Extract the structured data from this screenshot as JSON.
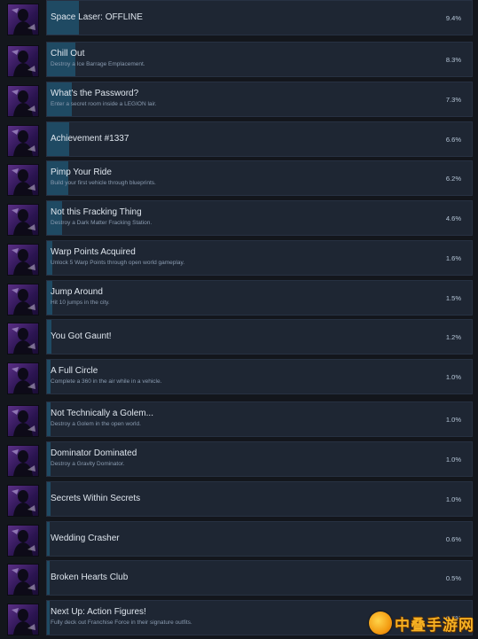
{
  "achievements": [
    {
      "title": "Space Laser: OFFLINE",
      "desc": "",
      "pct": "9.4%",
      "progress": 0.094,
      "icon": "space-laser-icon"
    },
    {
      "title": "Chill Out",
      "desc": "Destroy a Ice Barrage Emplacement.",
      "pct": "8.3%",
      "progress": 0.083,
      "icon": "chill-out-icon"
    },
    {
      "title": "What's the Password?",
      "desc": "Enter a secret room inside a LEGION lair.",
      "pct": "7.3%",
      "progress": 0.073,
      "icon": "password-icon"
    },
    {
      "title": "Achievement #1337",
      "desc": "",
      "pct": "6.6%",
      "progress": 0.066,
      "icon": "achievement-1337-icon"
    },
    {
      "title": "Pimp Your Ride",
      "desc": "Build your first vehicle through blueprints.",
      "pct": "6.2%",
      "progress": 0.062,
      "icon": "pimp-your-ride-icon"
    },
    {
      "title": "Not this Fracking Thing",
      "desc": "Destroy a Dark Matter Fracking Station.",
      "pct": "4.6%",
      "progress": 0.046,
      "icon": "fracking-icon"
    },
    {
      "title": "Warp Points Acquired",
      "desc": "Unlock 5 Warp Points through open world gameplay.",
      "pct": "1.6%",
      "progress": 0.016,
      "icon": "warp-points-icon"
    },
    {
      "title": "Jump Around",
      "desc": "Hit 10 jumps in the city.",
      "pct": "1.5%",
      "progress": 0.015,
      "icon": "jump-around-icon"
    },
    {
      "title": "You Got Gaunt!",
      "desc": "",
      "pct": "1.2%",
      "progress": 0.012,
      "icon": "gaunt-icon"
    },
    {
      "title": "A Full Circle",
      "desc": "Complete a 360 in the air while in a vehicle.",
      "pct": "1.0%",
      "progress": 0.01,
      "icon": "full-circle-icon"
    },
    {
      "title": "Not Technically a Golem...",
      "desc": "Destroy a Golem in the open world.",
      "pct": "1.0%",
      "progress": 0.01,
      "icon": "golem-icon"
    },
    {
      "title": "Dominator Dominated",
      "desc": "Destroy a Gravity Dominator.",
      "pct": "1.0%",
      "progress": 0.01,
      "icon": "dominator-icon"
    },
    {
      "title": "Secrets Within Secrets",
      "desc": "",
      "pct": "1.0%",
      "progress": 0.01,
      "icon": "secrets-icon"
    },
    {
      "title": "Wedding Crasher",
      "desc": "",
      "pct": "0.6%",
      "progress": 0.006,
      "icon": "wedding-crasher-icon"
    },
    {
      "title": "Broken Hearts Club",
      "desc": "",
      "pct": "0.5%",
      "progress": 0.005,
      "icon": "broken-hearts-icon"
    },
    {
      "title": "Next Up: Action Figures!",
      "desc": "Fully deck out Franchise Force in their signature outfits.",
      "pct": "0.5%",
      "progress": 0.005,
      "icon": "action-figures-icon"
    }
  ],
  "watermark": {
    "text": "中叠手游网",
    "icon": "watermark-logo-icon"
  }
}
